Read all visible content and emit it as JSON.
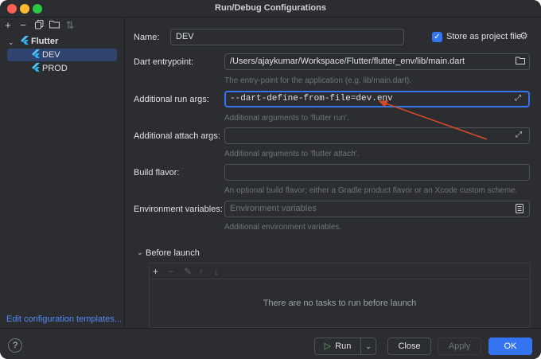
{
  "window": {
    "title": "Run/Debug Configurations"
  },
  "sidebar": {
    "toolbar_icons": [
      "add-icon",
      "remove-icon",
      "copy-icon",
      "new-folder-icon",
      "sort-icon"
    ],
    "tree": {
      "group_label": "Flutter",
      "items": [
        {
          "label": "DEV",
          "selected": true
        },
        {
          "label": "PROD",
          "selected": false
        }
      ]
    },
    "edit_templates_label": "Edit configuration templates..."
  },
  "form": {
    "name_label": "Name:",
    "name_value": "DEV",
    "store_label": "Store as project file",
    "store_checked": true,
    "entrypoint_label": "Dart entrypoint:",
    "entrypoint_value": "/Users/ajaykumar/Workspace/Flutter/flutter_env/lib/main.dart",
    "entrypoint_hint": "The entry-point for the application (e.g. lib/main.dart).",
    "run_args_label": "Additional run args:",
    "run_args_value": "--dart-define-from-file=dev.env",
    "run_args_hint": "Additional arguments to 'flutter run'.",
    "attach_args_label": "Additional attach args:",
    "attach_args_value": "",
    "attach_args_hint": "Additional arguments to 'flutter attach'.",
    "build_flavor_label": "Build flavor:",
    "build_flavor_value": "",
    "build_flavor_hint": "An optional build flavor; either a Gradle product flavor or an Xcode custom scheme.",
    "env_label": "Environment variables:",
    "env_placeholder": "Environment variables",
    "env_hint": "Additional environment variables."
  },
  "before_launch": {
    "header": "Before launch",
    "empty_text": "There are no tasks to run before launch"
  },
  "footer": {
    "help_label": "?",
    "run_label": "Run",
    "close_label": "Close",
    "apply_label": "Apply",
    "ok_label": "OK"
  },
  "colors": {
    "background": "#2b2d30",
    "accent": "#3574f0",
    "link": "#548af7",
    "annotation_arrow": "#d64b2a"
  }
}
